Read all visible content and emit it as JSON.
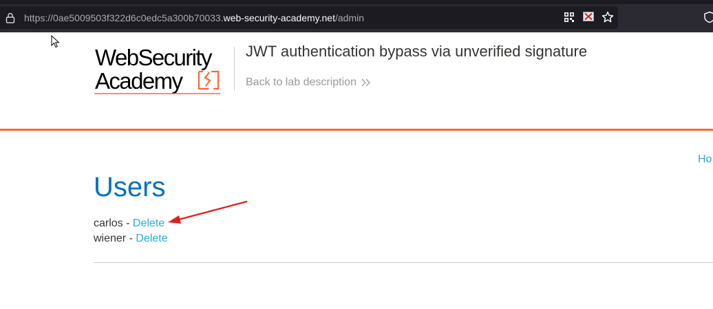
{
  "browser": {
    "url_prefix": "https://0ae5009503f322d6c0edc5a300b70033.",
    "url_domain": "web-security-academy.net",
    "url_path": "/admin",
    "icons": [
      "lock-icon",
      "qr-code-icon",
      "blocked-content-icon",
      "star-icon",
      "shield-icon"
    ]
  },
  "header": {
    "logo_line1": "WebSecurity",
    "logo_line2": "Academy",
    "lab_title": "JWT authentication bypass via unverified signature",
    "back_link": "Back to lab description",
    "back_icon": "double-chevron-right-icon"
  },
  "nav": {
    "home_label": "Ho"
  },
  "main": {
    "heading": "Users",
    "users": [
      {
        "name": "carlos",
        "separator": " - ",
        "action": "Delete"
      },
      {
        "name": "wiener",
        "separator": " - ",
        "action": "Delete"
      }
    ]
  },
  "colors": {
    "accent_orange": "#ff6633",
    "heading_blue": "#0071bc",
    "link_blue": "#29a9e0",
    "annotation_red": "#e0201b"
  }
}
